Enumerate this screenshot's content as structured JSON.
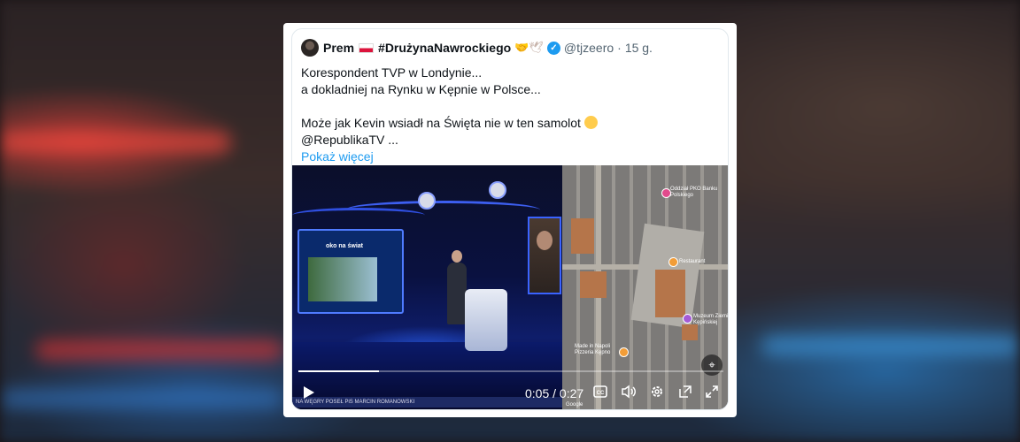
{
  "tweet": {
    "display_name": "Prem",
    "hashtag": "#DrużynaNawrockiego",
    "trailing_emoji": "🤝🕊",
    "handle": "@tjzeero",
    "separator": "·",
    "age": "15 g.",
    "lines": [
      "Korespondent TVP w Londynie...",
      "a dokladniej na Rynku w Kępnie w Polsce...",
      "Może jak Kevin wsiadł na Święta nie w ten samolot",
      "@RepublikaTV ..."
    ],
    "show_more": "Pokaż więcej"
  },
  "video": {
    "current_time": "0:05",
    "time_separator": "/",
    "duration": "0:27",
    "progress_fraction": 0.19,
    "screen_label": "oko na świat",
    "ticker": "NA WĘGRY POSEŁ PiS MARCIN ROMANOWSKI",
    "map_labels": [
      "Oddział PKO Banku Polskiego",
      "Restaurant",
      "Muzeum Ziemi Kępińskiej",
      "Made in Napoli Pizzeria Kępno",
      "Google"
    ]
  },
  "icons": {
    "verified": "verified-badge-icon",
    "play": "play-icon",
    "captions": "captions-icon",
    "volume": "volume-icon",
    "settings": "settings-gear-icon",
    "popout": "popout-icon",
    "fullscreen": "fullscreen-icon",
    "locate": "map-locate-icon"
  },
  "colors": {
    "link": "#1d9bf0",
    "text": "#0f1419",
    "muted": "#536471"
  }
}
